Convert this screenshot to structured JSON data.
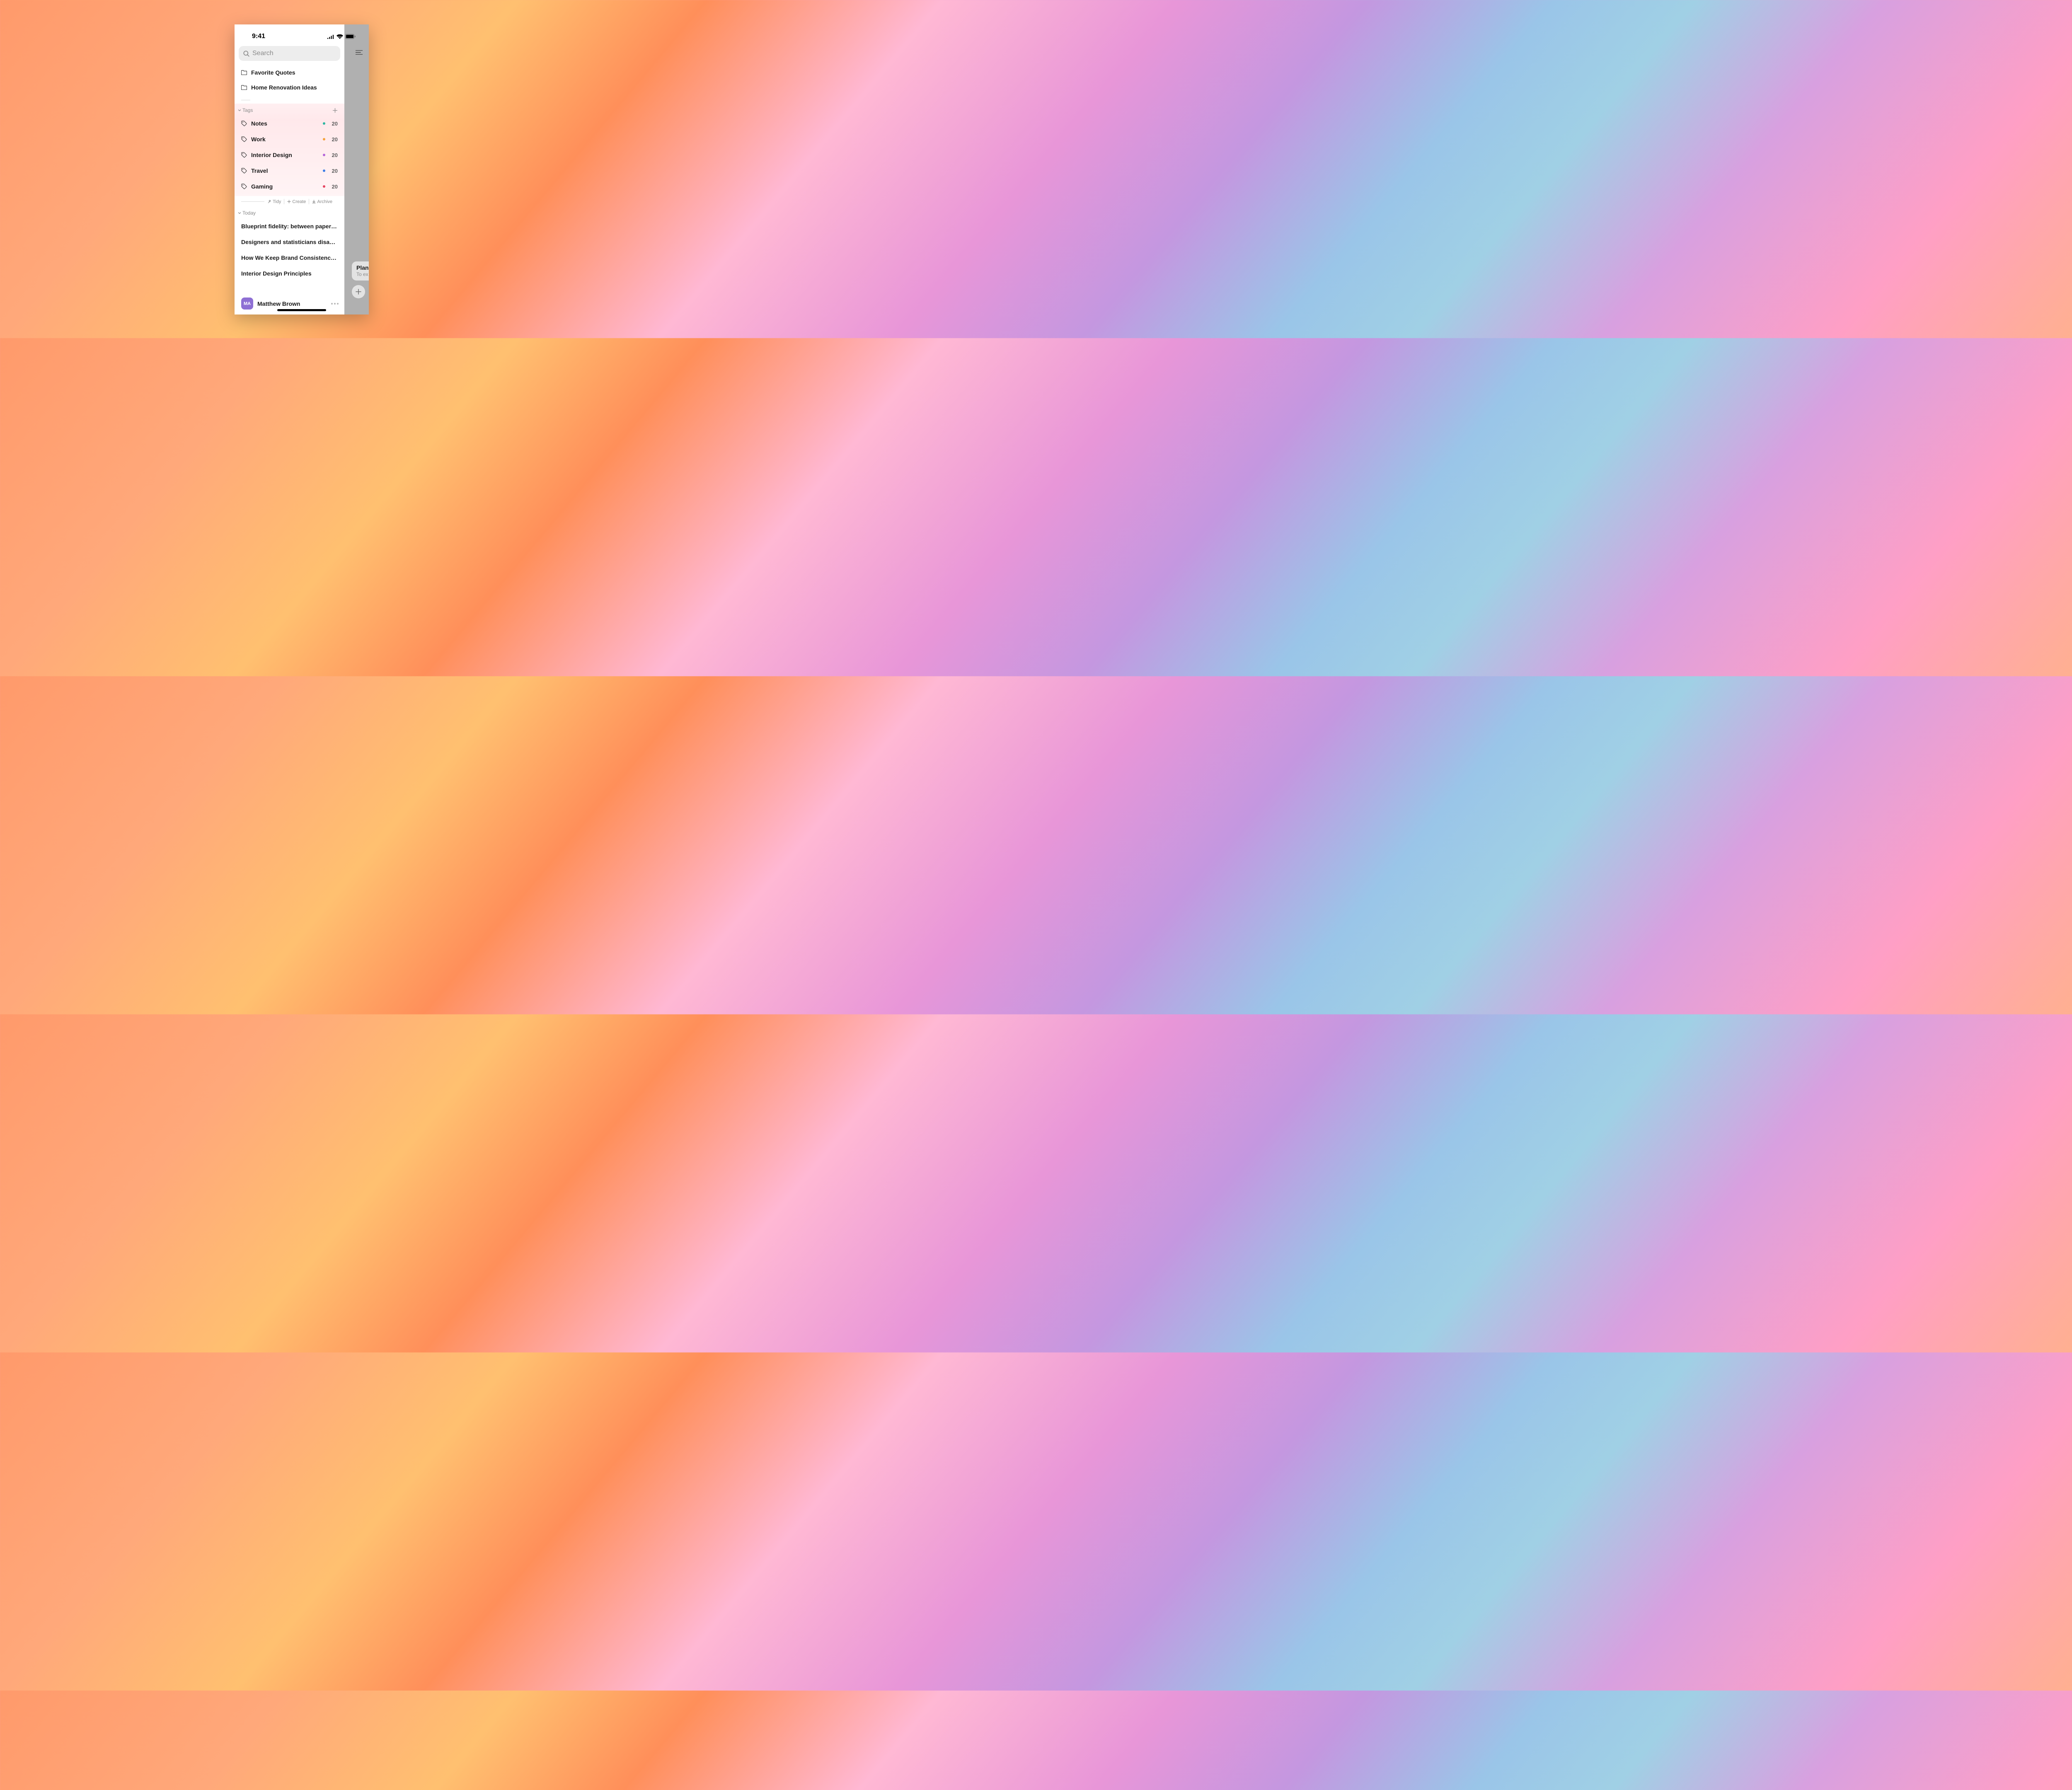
{
  "status": {
    "time": "9:41"
  },
  "search": {
    "placeholder": "Search"
  },
  "folders": [
    {
      "name": "Favorite Quotes"
    },
    {
      "name": "Home Renovation Ideas"
    }
  ],
  "tags_section": {
    "title": "Tags",
    "items": [
      {
        "name": "Notes",
        "color": "#2cb5a0",
        "count": "20"
      },
      {
        "name": "Work",
        "color": "#f5a23c",
        "count": "20"
      },
      {
        "name": "Interior Design",
        "color": "#b566d9",
        "count": "20"
      },
      {
        "name": "Travel",
        "color": "#3c7de5",
        "count": "20"
      },
      {
        "name": "Gaming",
        "color": "#e54560",
        "count": "20"
      }
    ]
  },
  "actions": {
    "tidy": "Tidy",
    "create": "Create",
    "archive": "Archive"
  },
  "today": {
    "title": "Today",
    "notes": [
      "Blueprint fidelity: between paper protot…",
      "Designers and statisticians disagree on…",
      "How We Keep Brand Consistency in Our…",
      "Interior Design Principles"
    ]
  },
  "user": {
    "initials": "MA",
    "name": "Matthew Brown"
  },
  "backcard": {
    "title": "Plan",
    "subtitle": "To ex"
  }
}
